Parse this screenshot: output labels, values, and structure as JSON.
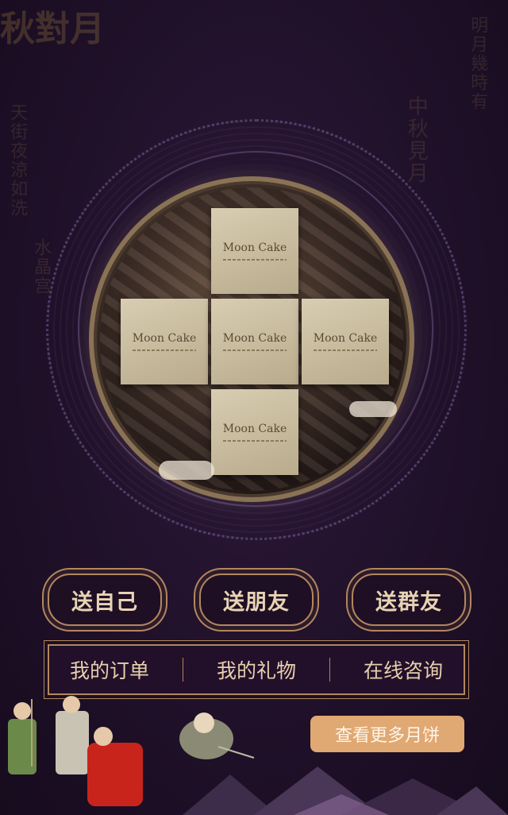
{
  "mooncake_boxes": [
    {
      "label": "Moon Cake"
    },
    {
      "label": "Moon Cake"
    },
    {
      "label": "Moon Cake"
    },
    {
      "label": "Moon Cake"
    },
    {
      "label": "Moon Cake"
    }
  ],
  "gift_buttons": [
    {
      "label": "送自己"
    },
    {
      "label": "送朋友"
    },
    {
      "label": "送群友"
    }
  ],
  "nav": {
    "orders": "我的订单",
    "gifts": "我的礼物",
    "consult": "在线咨询"
  },
  "more_button": "查看更多月饼",
  "background_calligraphy": {
    "left_top": "秋對月",
    "left_col1": "天街夜涼如洗",
    "left_col2": "水晶宫",
    "right_col1": "中秋見月",
    "right_col2": "明月幾時有"
  },
  "colors": {
    "background": "#1c0f24",
    "gold_border": "#b2875f",
    "button_text": "#e8d3b4",
    "more_button_bg": "#e0a872"
  }
}
